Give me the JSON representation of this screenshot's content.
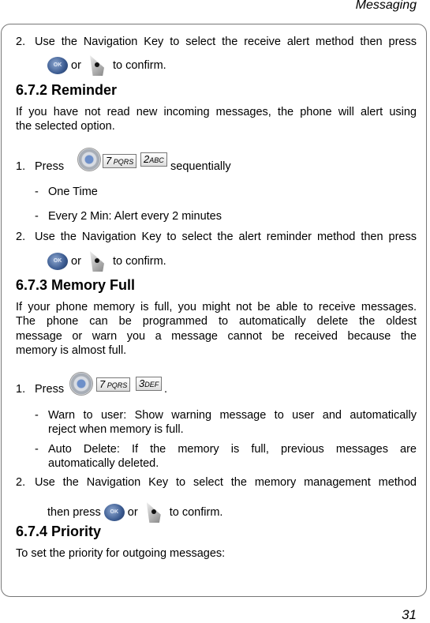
{
  "header": {
    "title": "Messaging"
  },
  "page_number": "31",
  "icons": {
    "ok": "OK",
    "key7": "7",
    "key7_sub": "PQRS",
    "key2": "2",
    "key2_sub": "ABC",
    "key3": "3",
    "key3_sub": "DEF"
  },
  "sec1": {
    "step2_num": "2.",
    "step2_text": "Use the Navigation Key to select the receive alert method then press",
    "or": "or",
    "confirm": "to confirm."
  },
  "sec_reminder": {
    "heading": "6.7.2 Reminder",
    "intro_line1": "If you have not read new incoming messages, the phone will alert using",
    "intro_line2": "the selected option.",
    "step1_num": "1.",
    "step1_press": "Press",
    "step1_suffix": "sequentially",
    "options": [
      "One Time",
      "Every 2 Min: Alert every 2 minutes"
    ],
    "dash": "-",
    "step2_num": "2.",
    "step2_text": "Use the Navigation Key to select the alert reminder method then press",
    "or": "or",
    "confirm": "to confirm."
  },
  "sec_memory": {
    "heading": "6.7.3 Memory Full",
    "intro_line1": "If your phone memory is full, you might not be able to receive messages.",
    "intro_line2": "The phone can be programmed to automatically delete the oldest",
    "intro_line3": "message or warn you a message cannot be received because the",
    "intro_line4": "memory is almost full.",
    "step1_num": "1.",
    "step1_press": "Press",
    "step1_suffix": ".",
    "options": [
      {
        "l1": "Warn to user: Show warning message to user and automatically",
        "l2": "reject when memory is full."
      },
      {
        "l1": "Auto Delete: If the memory is full, previous messages are",
        "l2": "automatically deleted."
      }
    ],
    "dash": "-",
    "step2_num": "2.",
    "step2_text": "Use the Navigation Key to select the memory management method",
    "step2_then": "then press",
    "or": "or",
    "confirm": "to confirm."
  },
  "sec_priority": {
    "heading": "6.7.4 Priority",
    "intro": "To set the priority for outgoing messages:"
  }
}
